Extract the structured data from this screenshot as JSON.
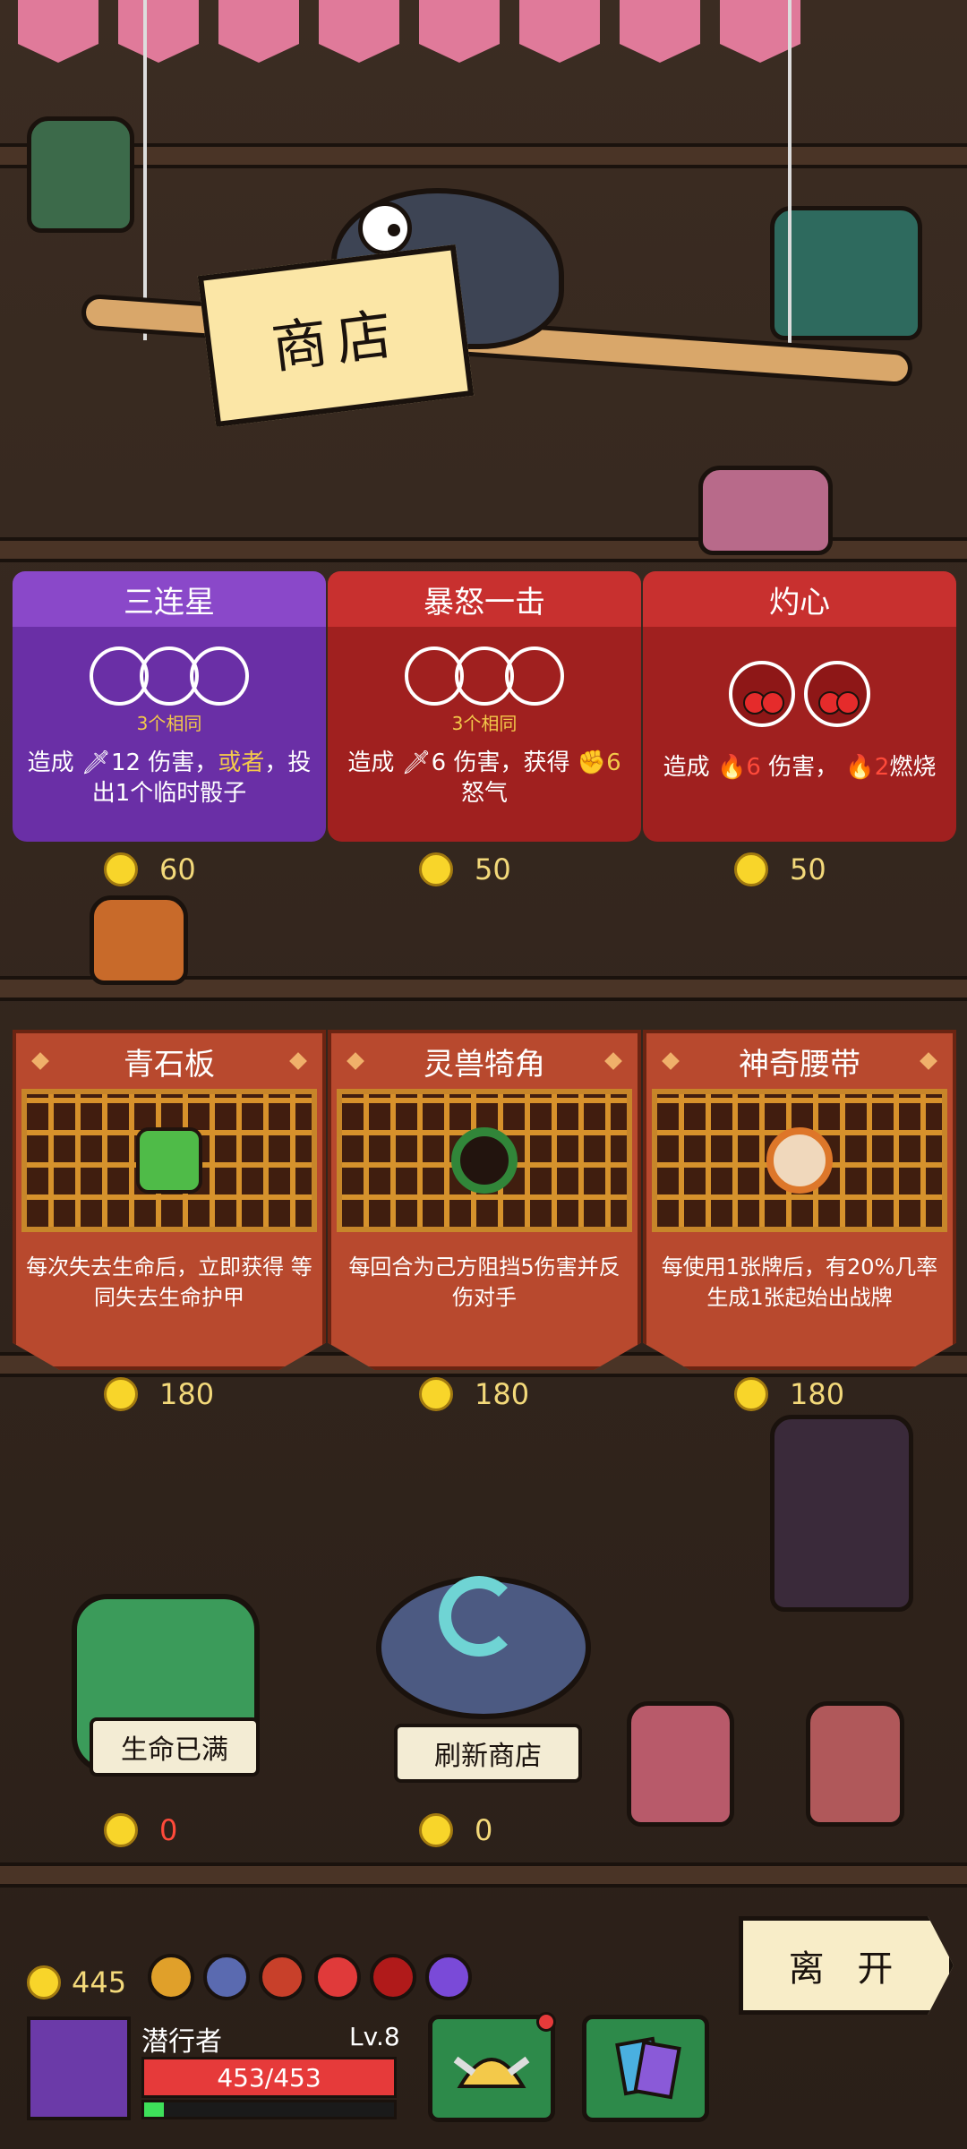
{
  "title": "商店",
  "skill_cards": [
    {
      "name": "三连星",
      "same_label": "3个相同",
      "desc_pre": "造成",
      "desc_dmg": "12",
      "desc_mid": "伤害，",
      "desc_hl": "或者",
      "desc_post": "，投出1个临时骰子",
      "price": "60",
      "color": "purple"
    },
    {
      "name": "暴怒一击",
      "same_label": "3个相同",
      "desc_pre": "造成",
      "desc_dmg": "6",
      "desc_mid": "伤害，获得",
      "desc_hl": "6",
      "desc_post": "怒气",
      "price": "50",
      "color": "red"
    },
    {
      "name": "灼心",
      "desc_pre": "造成",
      "desc_dmg": "6",
      "desc_mid": "伤害，",
      "desc_hl": "2",
      "desc_post": "燃烧",
      "price": "50",
      "color": "red"
    }
  ],
  "relic_cards": [
    {
      "name": "青石板",
      "desc": "每次失去生命后，立即获得 等同失去生命护甲",
      "price": "180",
      "icon": "green-stone-icon"
    },
    {
      "name": "灵兽犄角",
      "desc": "每回合为己方阻挡5伤害并反伤对手",
      "price": "180",
      "icon": "horn-ring-icon"
    },
    {
      "name": "神奇腰带",
      "desc": "每使用1张牌后，有20%几率生成1张起始出战牌",
      "price": "180",
      "icon": "belt-icon"
    }
  ],
  "heal": {
    "label": "生命已满",
    "price": "0"
  },
  "refresh": {
    "label": "刷新商店",
    "price": "0"
  },
  "leave_label": "离 开",
  "player": {
    "gold": "445",
    "name": "潜行者",
    "level": "Lv.8",
    "hp": "453/453",
    "xp_fraction": 0.08
  },
  "colors": {
    "coin": "#f8d52a",
    "hp": "#e63a3a",
    "xp": "#3ee05a",
    "purple": "#6a2fa6",
    "red": "#a0201f"
  }
}
